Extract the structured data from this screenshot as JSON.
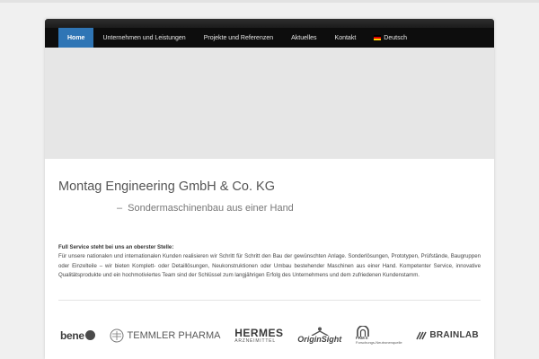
{
  "nav": {
    "items": [
      {
        "label": "Home",
        "active": true
      },
      {
        "label": "Unternehmen und Leistungen",
        "active": false
      },
      {
        "label": "Projekte und Referenzen",
        "active": false
      },
      {
        "label": "Aktuelles",
        "active": false
      },
      {
        "label": "Kontakt",
        "active": false
      }
    ],
    "language": {
      "label": "Deutsch",
      "icon": "german-flag-icon"
    }
  },
  "colors": {
    "nav_active": "#2f75b5",
    "nav_bg": "#0d0d0d",
    "hero_bg": "#e6e6e6"
  },
  "main": {
    "title": "Montag Engineering GmbH & Co. KG",
    "subtitle_dash": "–",
    "subtitle": "Sondermaschinenbau aus einer Hand",
    "intro_lead": "Full Service steht bei uns an oberster Stelle:",
    "intro_body": "Für unsere nationalen und internationalen Kunden realisieren wir Schritt für Schritt den Bau der gewünschten Anlage. Sonderlösungen, Prototypen, Prüfstände, Baugruppen oder Einzelteile – wir bieten Komplett- oder Detaillösungen, Neukonstruktionen oder Umbau bestehender Maschinen aus einer Hand. Kompetenter Service, innovative Qualitätsprodukte und ein hochmotiviertes Team sind der Schlüssel zum langjährigen Erfolg des Unternehmens und dem zufriedenen Kundenstamm."
  },
  "logos": {
    "bene": "bene",
    "temmler": "TEMMLER PHARMA",
    "hermes": "HERMES",
    "hermes_sub": "ARZNEIMITTEL",
    "origin": "OriginSight",
    "frm_title": "FRM II",
    "frm_sub": "Forschungs-Neutronenquelle",
    "brainlab": "BRAINLAB"
  }
}
